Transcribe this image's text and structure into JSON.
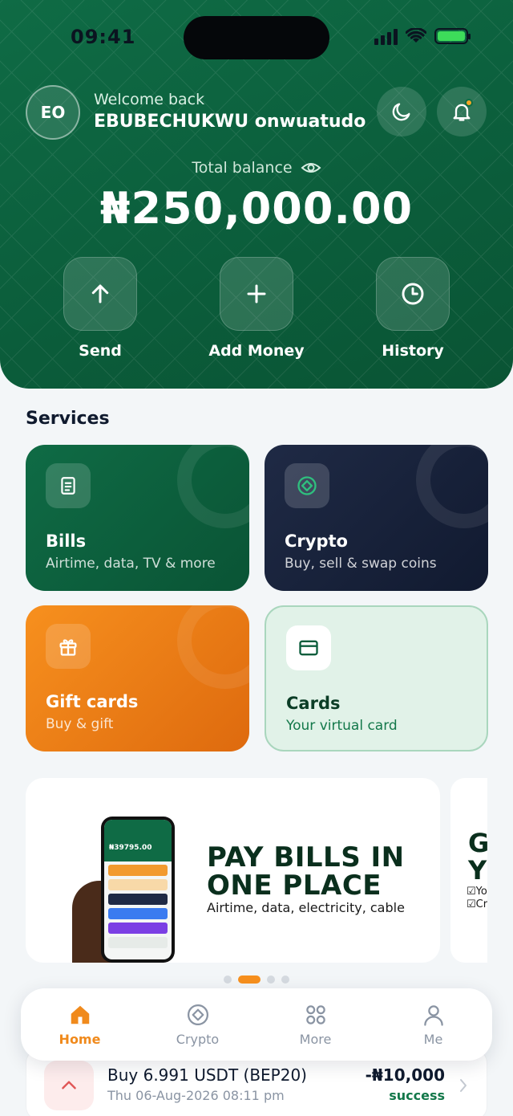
{
  "status_bar": {
    "time": "09:41"
  },
  "header": {
    "avatar_initials": "EO",
    "welcome": "Welcome back",
    "username": "EBUBECHUKWU onwuatudo",
    "total_balance_label": "Total balance",
    "balance": "₦250,000.00"
  },
  "actions": [
    {
      "label": "Send",
      "icon": "arrow-up-icon"
    },
    {
      "label": "Add Money",
      "icon": "plus-icon"
    },
    {
      "label": "History",
      "icon": "clock-icon"
    }
  ],
  "services": {
    "title": "Services",
    "items": [
      {
        "title": "Bills",
        "subtitle": "Airtime, data, TV & more",
        "icon": "document-icon"
      },
      {
        "title": "Crypto",
        "subtitle": "Buy, sell & swap coins",
        "icon": "coin-icon"
      },
      {
        "title": "Gift cards",
        "subtitle": "Buy & gift",
        "icon": "gift-icon"
      },
      {
        "title": "Cards",
        "subtitle": "Your virtual card",
        "icon": "card-icon"
      }
    ]
  },
  "banner": {
    "headline_1": "PAY BILLS IN",
    "headline_2": "ONE PLACE",
    "subtitle": "Airtime, data, electricity, cable",
    "phone_amount": "₦39795.00",
    "peek_text_1": "G",
    "peek_text_2": "Y",
    "peek_line_1": "☑Yo",
    "peek_line_2": "☑Cr"
  },
  "carousel": {
    "count": 4,
    "active_index": 1
  },
  "bottom_nav": {
    "items": [
      {
        "label": "Home",
        "icon": "home-icon",
        "active": true
      },
      {
        "label": "Crypto",
        "icon": "coin-icon",
        "active": false
      },
      {
        "label": "More",
        "icon": "grid-icon",
        "active": false
      },
      {
        "label": "Me",
        "icon": "user-icon",
        "active": false
      }
    ]
  },
  "transaction": {
    "title": "Buy 6.991 USDT (BEP20)",
    "date": "Thu 06-Aug-2026 08:11 pm",
    "amount": "-₦10,000",
    "status": "success"
  },
  "colors": {
    "primary_green": "#0f6b45",
    "accent_orange": "#f7901e",
    "crypto_navy": "#1f2a45",
    "success_green": "#13784a"
  }
}
